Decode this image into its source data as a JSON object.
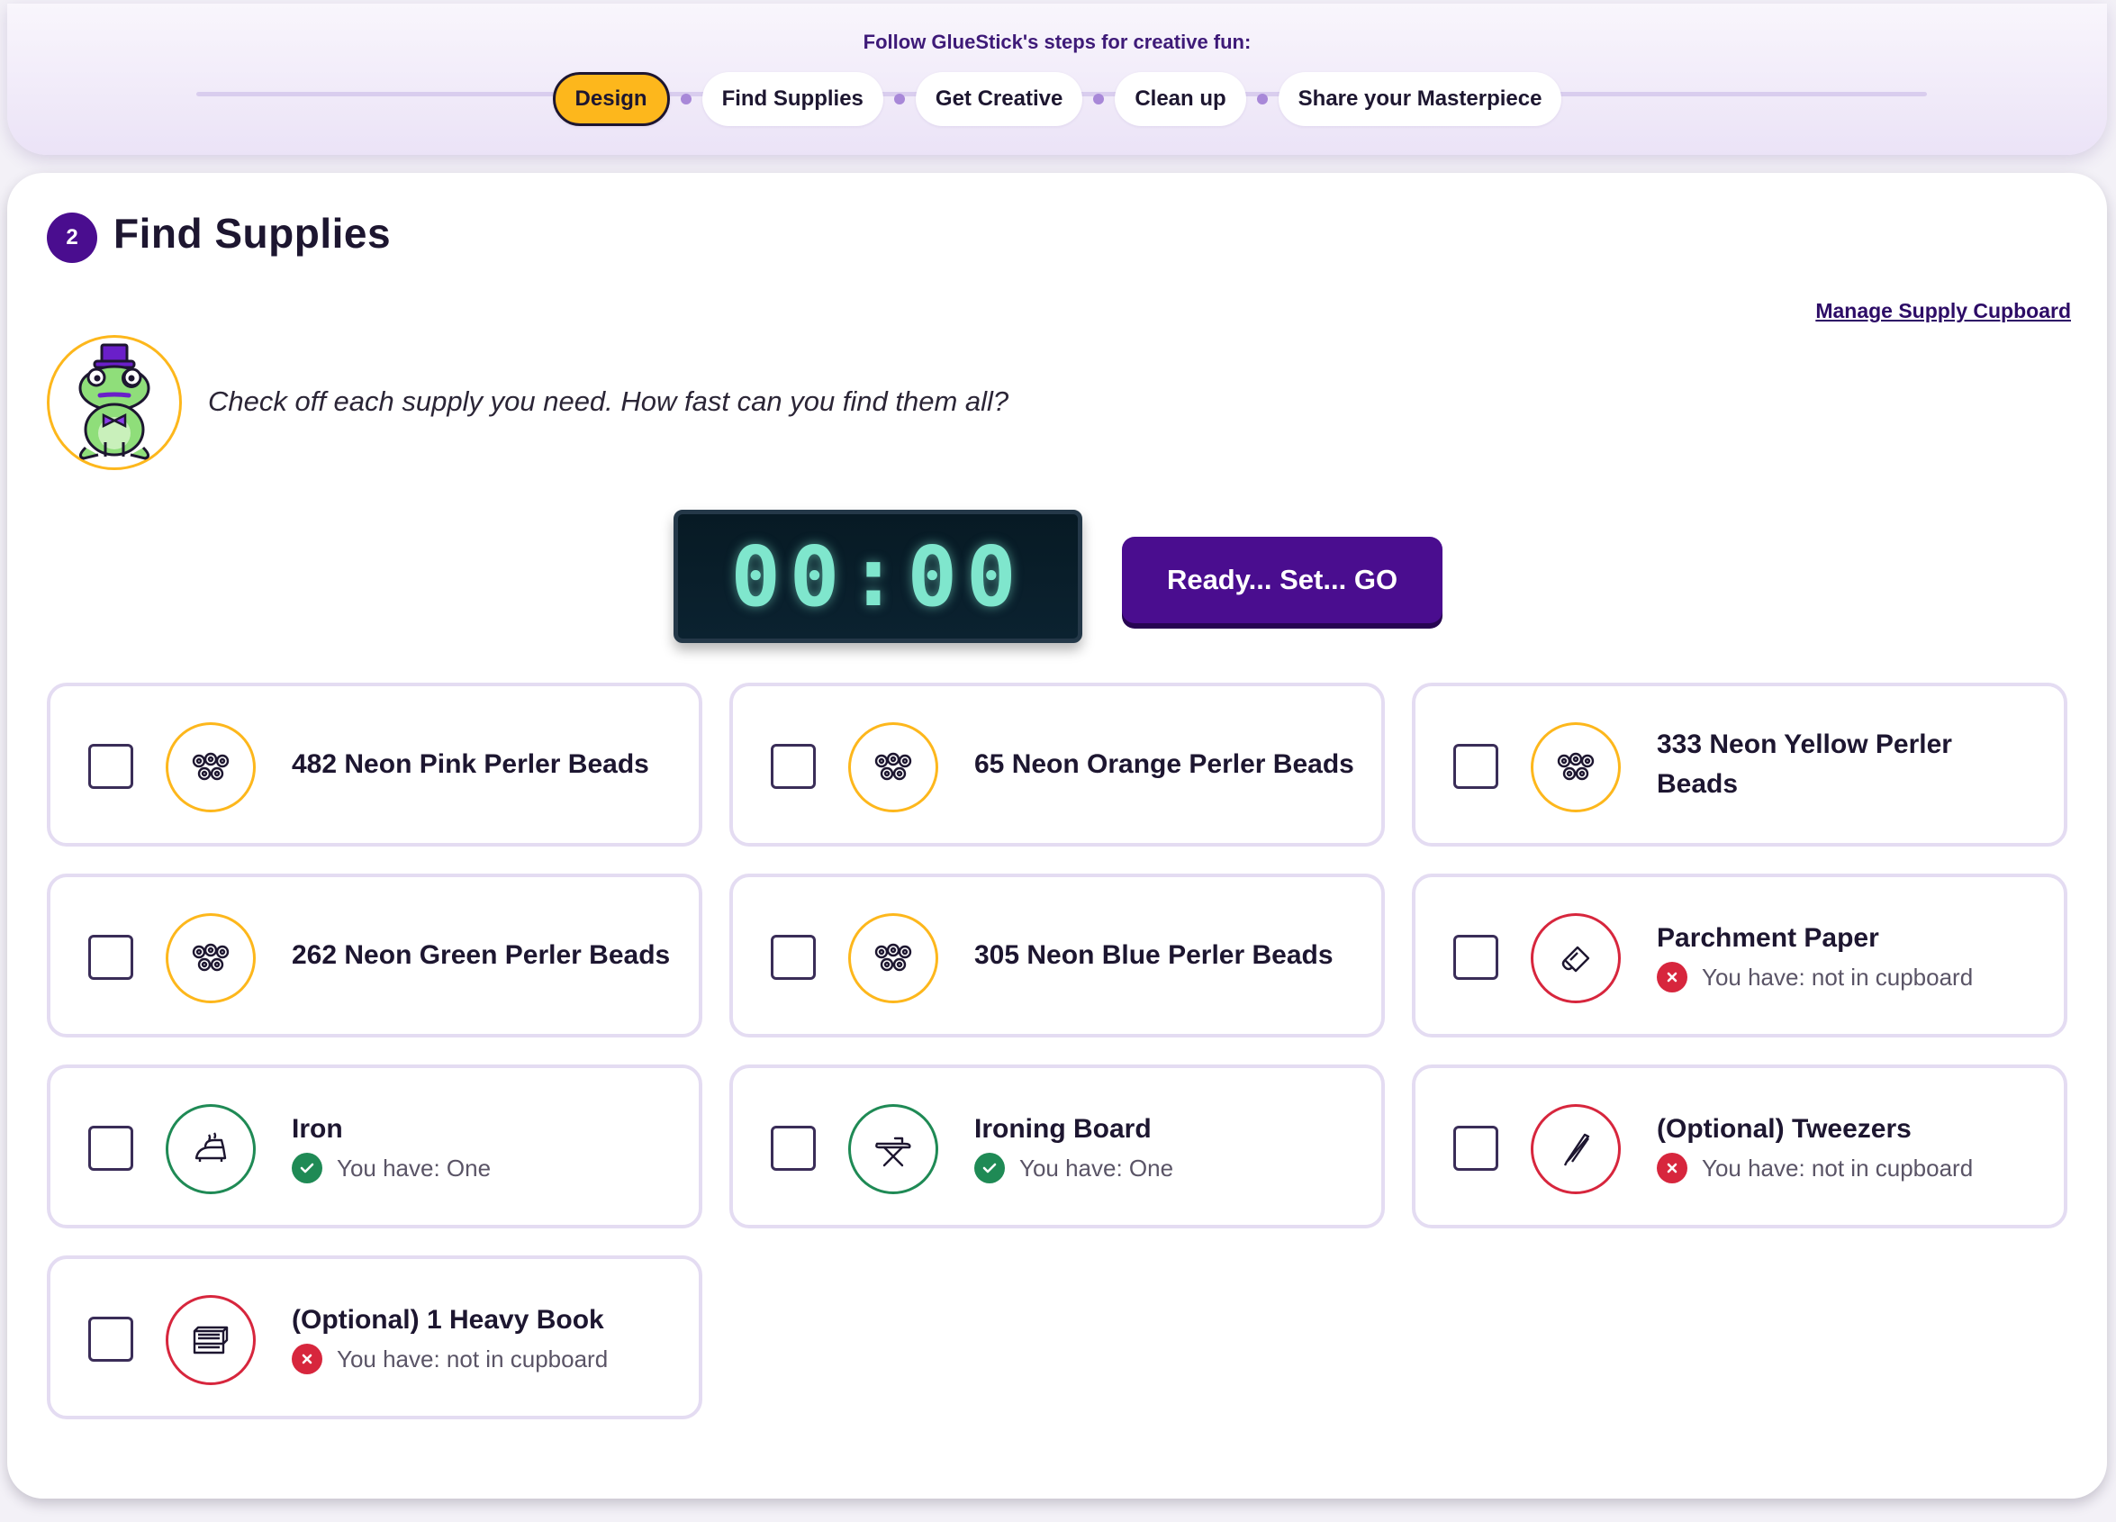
{
  "stepper": {
    "intro": "Follow GlueStick's steps for creative fun:",
    "steps": [
      {
        "label": "Design",
        "active": true
      },
      {
        "label": "Find Supplies",
        "active": false
      },
      {
        "label": "Get Creative",
        "active": false
      },
      {
        "label": "Clean up",
        "active": false
      },
      {
        "label": "Share your Masterpiece",
        "active": false
      }
    ]
  },
  "header": {
    "step_number": "2",
    "title": "Find Supplies",
    "manage_link": "Manage Supply Cupboard"
  },
  "guide": {
    "mascot_icon": "frog-mascot-icon",
    "instructions": "Check off each supply you need. How fast can you find them all?"
  },
  "timer": {
    "display": "00:00",
    "button_label": "Ready... Set... GO"
  },
  "colors": {
    "accent": "#4a0d8f",
    "active_step": "#fdb71c",
    "have": "#1f8a55",
    "missing": "#d7263d",
    "timer_digits": "#7fe6cd"
  },
  "supplies": [
    {
      "name": "482 Neon Pink Perler Beads",
      "icon": "beads-icon",
      "checked": false,
      "status": null
    },
    {
      "name": "65 Neon Orange Perler Beads",
      "icon": "beads-icon",
      "checked": false,
      "status": null
    },
    {
      "name": "333 Neon Yellow Perler Beads",
      "icon": "beads-icon",
      "checked": false,
      "status": null
    },
    {
      "name": "262 Neon Green Perler Beads",
      "icon": "beads-icon",
      "checked": false,
      "status": null
    },
    {
      "name": "305 Neon Blue Perler Beads",
      "icon": "beads-icon",
      "checked": false,
      "status": null
    },
    {
      "name": "Parchment Paper",
      "icon": "parchment-paper-icon",
      "checked": false,
      "status": "missing",
      "status_text": "You have: not in cupboard"
    },
    {
      "name": "Iron",
      "icon": "iron-icon",
      "checked": false,
      "status": "ok",
      "status_text": "You have: One"
    },
    {
      "name": "Ironing Board",
      "icon": "ironing-board-icon",
      "checked": false,
      "status": "ok",
      "status_text": "You have: One"
    },
    {
      "name": "(Optional) Tweezers",
      "icon": "tweezers-icon",
      "checked": false,
      "status": "missing",
      "status_text": "You have: not in cupboard"
    },
    {
      "name": "(Optional) 1 Heavy Book",
      "icon": "book-icon",
      "checked": false,
      "status": "missing",
      "status_text": "You have: not in cupboard"
    }
  ]
}
